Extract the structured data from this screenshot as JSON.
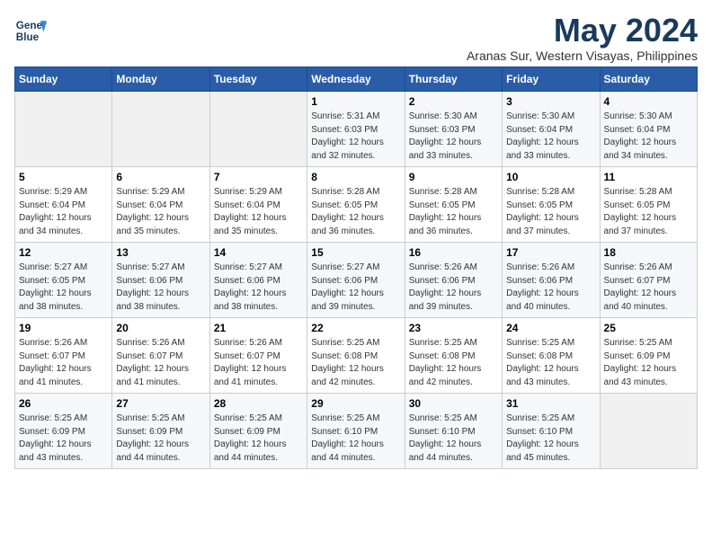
{
  "logo": {
    "line1": "General",
    "line2": "Blue"
  },
  "title": "May 2024",
  "location": "Aranas Sur, Western Visayas, Philippines",
  "weekdays": [
    "Sunday",
    "Monday",
    "Tuesday",
    "Wednesday",
    "Thursday",
    "Friday",
    "Saturday"
  ],
  "weeks": [
    [
      {
        "day": "",
        "sunrise": "",
        "sunset": "",
        "daylight": ""
      },
      {
        "day": "",
        "sunrise": "",
        "sunset": "",
        "daylight": ""
      },
      {
        "day": "",
        "sunrise": "",
        "sunset": "",
        "daylight": ""
      },
      {
        "day": "1",
        "sunrise": "Sunrise: 5:31 AM",
        "sunset": "Sunset: 6:03 PM",
        "daylight": "Daylight: 12 hours and 32 minutes."
      },
      {
        "day": "2",
        "sunrise": "Sunrise: 5:30 AM",
        "sunset": "Sunset: 6:03 PM",
        "daylight": "Daylight: 12 hours and 33 minutes."
      },
      {
        "day": "3",
        "sunrise": "Sunrise: 5:30 AM",
        "sunset": "Sunset: 6:04 PM",
        "daylight": "Daylight: 12 hours and 33 minutes."
      },
      {
        "day": "4",
        "sunrise": "Sunrise: 5:30 AM",
        "sunset": "Sunset: 6:04 PM",
        "daylight": "Daylight: 12 hours and 34 minutes."
      }
    ],
    [
      {
        "day": "5",
        "sunrise": "Sunrise: 5:29 AM",
        "sunset": "Sunset: 6:04 PM",
        "daylight": "Daylight: 12 hours and 34 minutes."
      },
      {
        "day": "6",
        "sunrise": "Sunrise: 5:29 AM",
        "sunset": "Sunset: 6:04 PM",
        "daylight": "Daylight: 12 hours and 35 minutes."
      },
      {
        "day": "7",
        "sunrise": "Sunrise: 5:29 AM",
        "sunset": "Sunset: 6:04 PM",
        "daylight": "Daylight: 12 hours and 35 minutes."
      },
      {
        "day": "8",
        "sunrise": "Sunrise: 5:28 AM",
        "sunset": "Sunset: 6:05 PM",
        "daylight": "Daylight: 12 hours and 36 minutes."
      },
      {
        "day": "9",
        "sunrise": "Sunrise: 5:28 AM",
        "sunset": "Sunset: 6:05 PM",
        "daylight": "Daylight: 12 hours and 36 minutes."
      },
      {
        "day": "10",
        "sunrise": "Sunrise: 5:28 AM",
        "sunset": "Sunset: 6:05 PM",
        "daylight": "Daylight: 12 hours and 37 minutes."
      },
      {
        "day": "11",
        "sunrise": "Sunrise: 5:28 AM",
        "sunset": "Sunset: 6:05 PM",
        "daylight": "Daylight: 12 hours and 37 minutes."
      }
    ],
    [
      {
        "day": "12",
        "sunrise": "Sunrise: 5:27 AM",
        "sunset": "Sunset: 6:05 PM",
        "daylight": "Daylight: 12 hours and 38 minutes."
      },
      {
        "day": "13",
        "sunrise": "Sunrise: 5:27 AM",
        "sunset": "Sunset: 6:06 PM",
        "daylight": "Daylight: 12 hours and 38 minutes."
      },
      {
        "day": "14",
        "sunrise": "Sunrise: 5:27 AM",
        "sunset": "Sunset: 6:06 PM",
        "daylight": "Daylight: 12 hours and 38 minutes."
      },
      {
        "day": "15",
        "sunrise": "Sunrise: 5:27 AM",
        "sunset": "Sunset: 6:06 PM",
        "daylight": "Daylight: 12 hours and 39 minutes."
      },
      {
        "day": "16",
        "sunrise": "Sunrise: 5:26 AM",
        "sunset": "Sunset: 6:06 PM",
        "daylight": "Daylight: 12 hours and 39 minutes."
      },
      {
        "day": "17",
        "sunrise": "Sunrise: 5:26 AM",
        "sunset": "Sunset: 6:06 PM",
        "daylight": "Daylight: 12 hours and 40 minutes."
      },
      {
        "day": "18",
        "sunrise": "Sunrise: 5:26 AM",
        "sunset": "Sunset: 6:07 PM",
        "daylight": "Daylight: 12 hours and 40 minutes."
      }
    ],
    [
      {
        "day": "19",
        "sunrise": "Sunrise: 5:26 AM",
        "sunset": "Sunset: 6:07 PM",
        "daylight": "Daylight: 12 hours and 41 minutes."
      },
      {
        "day": "20",
        "sunrise": "Sunrise: 5:26 AM",
        "sunset": "Sunset: 6:07 PM",
        "daylight": "Daylight: 12 hours and 41 minutes."
      },
      {
        "day": "21",
        "sunrise": "Sunrise: 5:26 AM",
        "sunset": "Sunset: 6:07 PM",
        "daylight": "Daylight: 12 hours and 41 minutes."
      },
      {
        "day": "22",
        "sunrise": "Sunrise: 5:25 AM",
        "sunset": "Sunset: 6:08 PM",
        "daylight": "Daylight: 12 hours and 42 minutes."
      },
      {
        "day": "23",
        "sunrise": "Sunrise: 5:25 AM",
        "sunset": "Sunset: 6:08 PM",
        "daylight": "Daylight: 12 hours and 42 minutes."
      },
      {
        "day": "24",
        "sunrise": "Sunrise: 5:25 AM",
        "sunset": "Sunset: 6:08 PM",
        "daylight": "Daylight: 12 hours and 43 minutes."
      },
      {
        "day": "25",
        "sunrise": "Sunrise: 5:25 AM",
        "sunset": "Sunset: 6:09 PM",
        "daylight": "Daylight: 12 hours and 43 minutes."
      }
    ],
    [
      {
        "day": "26",
        "sunrise": "Sunrise: 5:25 AM",
        "sunset": "Sunset: 6:09 PM",
        "daylight": "Daylight: 12 hours and 43 minutes."
      },
      {
        "day": "27",
        "sunrise": "Sunrise: 5:25 AM",
        "sunset": "Sunset: 6:09 PM",
        "daylight": "Daylight: 12 hours and 44 minutes."
      },
      {
        "day": "28",
        "sunrise": "Sunrise: 5:25 AM",
        "sunset": "Sunset: 6:09 PM",
        "daylight": "Daylight: 12 hours and 44 minutes."
      },
      {
        "day": "29",
        "sunrise": "Sunrise: 5:25 AM",
        "sunset": "Sunset: 6:10 PM",
        "daylight": "Daylight: 12 hours and 44 minutes."
      },
      {
        "day": "30",
        "sunrise": "Sunrise: 5:25 AM",
        "sunset": "Sunset: 6:10 PM",
        "daylight": "Daylight: 12 hours and 44 minutes."
      },
      {
        "day": "31",
        "sunrise": "Sunrise: 5:25 AM",
        "sunset": "Sunset: 6:10 PM",
        "daylight": "Daylight: 12 hours and 45 minutes."
      },
      {
        "day": "",
        "sunrise": "",
        "sunset": "",
        "daylight": ""
      }
    ]
  ]
}
